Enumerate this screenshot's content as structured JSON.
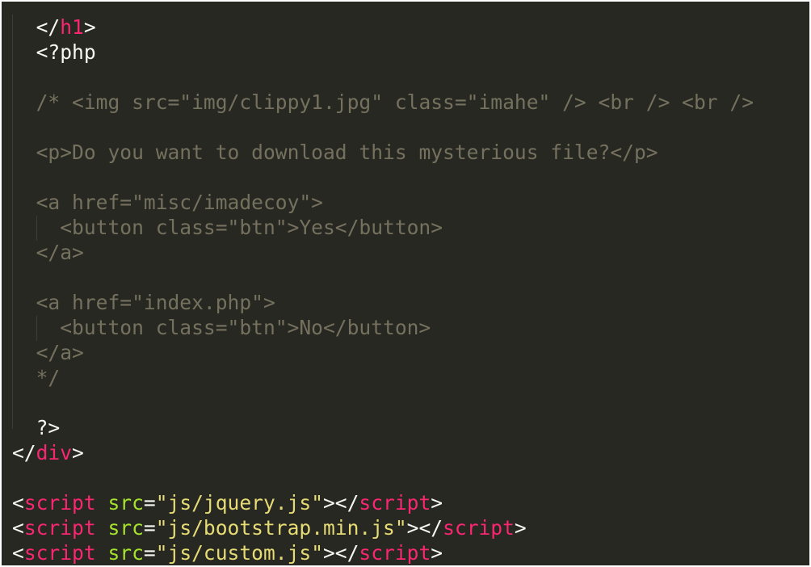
{
  "editor": {
    "theme_colors": {
      "background": "#272822",
      "tag": "#f92672",
      "attribute": "#a6e22e",
      "string": "#e6db74",
      "comment": "#75715e",
      "text": "#f8f8f2"
    },
    "lines": [
      [
        {
          "t": "  "
        },
        {
          "t": "</",
          "c": "punct"
        },
        {
          "t": "h1",
          "c": "tag"
        },
        {
          "t": ">",
          "c": "punct"
        }
      ],
      [
        {
          "t": "  "
        },
        {
          "t": "<?php",
          "c": "php"
        }
      ],
      [],
      [
        {
          "t": "  "
        },
        {
          "t": "/* <img src=\"img/clippy1.jpg\" class=\"imahe\" /> <br /> <br />",
          "c": "comment"
        }
      ],
      [],
      [
        {
          "t": "  "
        },
        {
          "t": "<p>Do you want to download this mysterious file?</p>",
          "c": "comment"
        }
      ],
      [],
      [
        {
          "t": "  "
        },
        {
          "t": "<a href=\"misc/imadecoy\">",
          "c": "comment"
        }
      ],
      [
        {
          "t": "    "
        },
        {
          "t": "<button class=\"btn\">Yes</button>",
          "c": "comment"
        }
      ],
      [
        {
          "t": "  "
        },
        {
          "t": "</a>",
          "c": "comment"
        }
      ],
      [],
      [
        {
          "t": "  "
        },
        {
          "t": "<a href=\"index.php\">",
          "c": "comment"
        }
      ],
      [
        {
          "t": "    "
        },
        {
          "t": "<button class=\"btn\">No</button>",
          "c": "comment"
        }
      ],
      [
        {
          "t": "  "
        },
        {
          "t": "</a>",
          "c": "comment"
        }
      ],
      [
        {
          "t": "  "
        },
        {
          "t": "*/",
          "c": "comment"
        }
      ],
      [],
      [
        {
          "t": "  "
        },
        {
          "t": "?>",
          "c": "php"
        }
      ],
      [
        {
          "t": "</",
          "c": "punct"
        },
        {
          "t": "div",
          "c": "tag"
        },
        {
          "t": ">",
          "c": "punct"
        }
      ],
      [],
      [
        {
          "t": "<",
          "c": "punct"
        },
        {
          "t": "script",
          "c": "tag"
        },
        {
          "t": " "
        },
        {
          "t": "src",
          "c": "attr"
        },
        {
          "t": "=",
          "c": "punct"
        },
        {
          "t": "\"js/jquery.js\"",
          "c": "string"
        },
        {
          "t": "></",
          "c": "punct"
        },
        {
          "t": "script",
          "c": "tag"
        },
        {
          "t": ">",
          "c": "punct"
        }
      ],
      [
        {
          "t": "<",
          "c": "punct"
        },
        {
          "t": "script",
          "c": "tag"
        },
        {
          "t": " "
        },
        {
          "t": "src",
          "c": "attr"
        },
        {
          "t": "=",
          "c": "punct"
        },
        {
          "t": "\"js/bootstrap.min.js\"",
          "c": "string"
        },
        {
          "t": "></",
          "c": "punct"
        },
        {
          "t": "script",
          "c": "tag"
        },
        {
          "t": ">",
          "c": "punct"
        }
      ],
      [
        {
          "t": "<",
          "c": "punct"
        },
        {
          "t": "script",
          "c": "tag"
        },
        {
          "t": " "
        },
        {
          "t": "src",
          "c": "attr"
        },
        {
          "t": "=",
          "c": "punct"
        },
        {
          "t": "\"js/custom.js\"",
          "c": "string"
        },
        {
          "t": "></",
          "c": "punct"
        },
        {
          "t": "script",
          "c": "tag"
        },
        {
          "t": ">",
          "c": "punct"
        }
      ]
    ]
  }
}
